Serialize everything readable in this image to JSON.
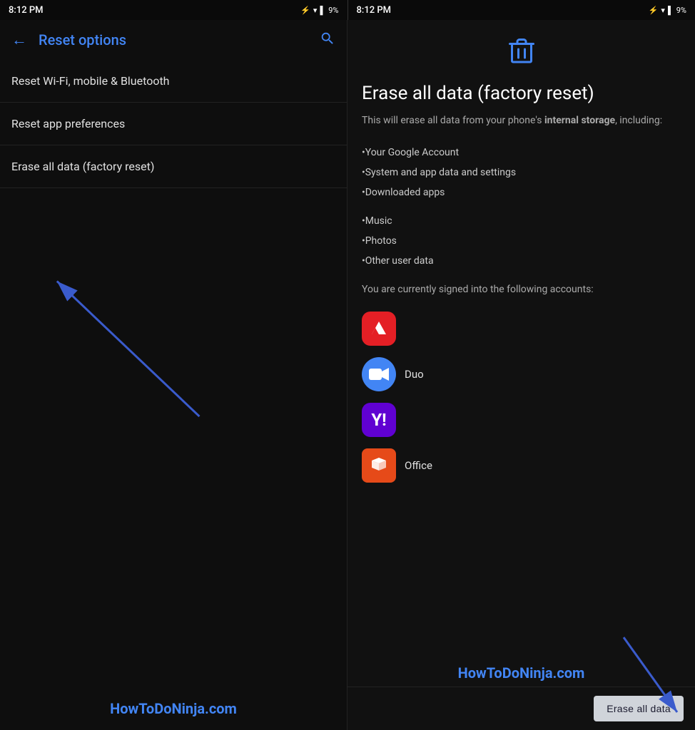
{
  "left": {
    "status": {
      "time": "8:12 PM",
      "battery": "9%"
    },
    "topBar": {
      "backLabel": "←",
      "title": "Reset options",
      "searchIcon": "🔍"
    },
    "menuItems": [
      {
        "label": "Reset Wi-Fi, mobile & Bluetooth"
      },
      {
        "label": "Reset app preferences"
      },
      {
        "label": "Erase all data (factory reset)"
      }
    ]
  },
  "right": {
    "status": {
      "time": "8:12 PM",
      "battery": "9%"
    },
    "title": "Erase all data (factory reset)",
    "descPrefix": "This will erase all data from your phone's ",
    "descBold": "internal storage",
    "descSuffix": ", including:",
    "dataItems": [
      "•Your Google Account",
      "•System and app data and settings",
      "•Downloaded apps",
      "",
      "•Music",
      "•Photos",
      "•Other user data"
    ],
    "accountsLabel": "You are currently signed into the following accounts:",
    "accounts": [
      {
        "name": "Adobe",
        "icon": "adobe"
      },
      {
        "name": "Duo",
        "icon": "duo"
      },
      {
        "name": "Yahoo",
        "icon": "yahoo"
      },
      {
        "name": "Office",
        "icon": "office"
      }
    ],
    "eraseButton": "Erase all data"
  },
  "watermark": "HowToDoNinja.com"
}
